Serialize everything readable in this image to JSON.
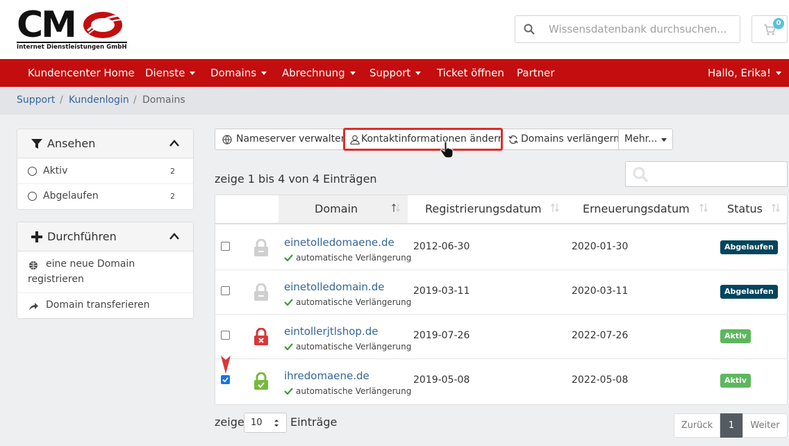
{
  "header": {
    "logo_text": "CM",
    "logo_subtitle": "Internet Dienstleistungen GmbH",
    "search_placeholder": "Wissensdatenbank durchsuchen...",
    "cart_count": "0"
  },
  "nav": {
    "items": [
      {
        "label": "Kundencenter Home",
        "dropdown": false
      },
      {
        "label": "Dienste",
        "dropdown": true
      },
      {
        "label": "Domains",
        "dropdown": true
      },
      {
        "label": "Abrechnung",
        "dropdown": true
      },
      {
        "label": "Support",
        "dropdown": true
      },
      {
        "label": "Ticket öffnen",
        "dropdown": false
      },
      {
        "label": "Partner",
        "dropdown": false
      }
    ],
    "user_greeting": "Hallo, Erika!"
  },
  "breadcrumb": [
    "Support",
    "Kundenlogin",
    "Domains"
  ],
  "sidebar": {
    "view_panel": {
      "title": "Ansehen",
      "items": [
        {
          "label": "Aktiv",
          "count": "2"
        },
        {
          "label": "Abgelaufen",
          "count": "2"
        }
      ]
    },
    "actions_panel": {
      "title": "Durchführen",
      "items": [
        {
          "label_line1": "eine neue Domain",
          "label_line2": "registrieren",
          "icon": "globe-icon"
        },
        {
          "label_line1": "Domain transferieren",
          "icon": "share-icon"
        }
      ]
    }
  },
  "toolbar": {
    "nameservers": "Nameserver verwalten",
    "contact": "Kontaktinformationen ändern",
    "renew": "Domains verlängern",
    "more": "Mehr..."
  },
  "table": {
    "showing": "zeige 1 bis 4 von 4 Einträgen",
    "columns": [
      "Domain",
      "Registrierungsdatum",
      "Erneuerungsdatum",
      "Status"
    ],
    "auto_renew_label": "automatische Verlängerung",
    "rows": [
      {
        "domain": "einetolledomaene.de",
        "registered": "2012-06-30",
        "renewal": "2020-01-30",
        "status": "Abgelaufen",
        "lock": "grey",
        "checked": false
      },
      {
        "domain": "einetolledomain.de",
        "registered": "2019-03-11",
        "renewal": "2020-03-11",
        "status": "Abgelaufen",
        "lock": "grey",
        "checked": false
      },
      {
        "domain": "eintollerjtlshop.de",
        "registered": "2019-07-26",
        "renewal": "2022-07-26",
        "status": "Aktiv",
        "lock": "red",
        "checked": false
      },
      {
        "domain": "ihredomaene.de",
        "registered": "2019-05-08",
        "renewal": "2022-05-08",
        "status": "Aktiv",
        "lock": "green",
        "checked": true
      }
    ]
  },
  "footer": {
    "show_prefix": "zeige",
    "page_size": "10",
    "show_suffix": "Einträge",
    "prev": "Zurück",
    "page": "1",
    "next": "Weiter"
  },
  "colors": {
    "nav_red": "#c40d0e",
    "status_expired": "#02455e",
    "status_active": "#5cb85c",
    "link_blue": "#336699"
  }
}
